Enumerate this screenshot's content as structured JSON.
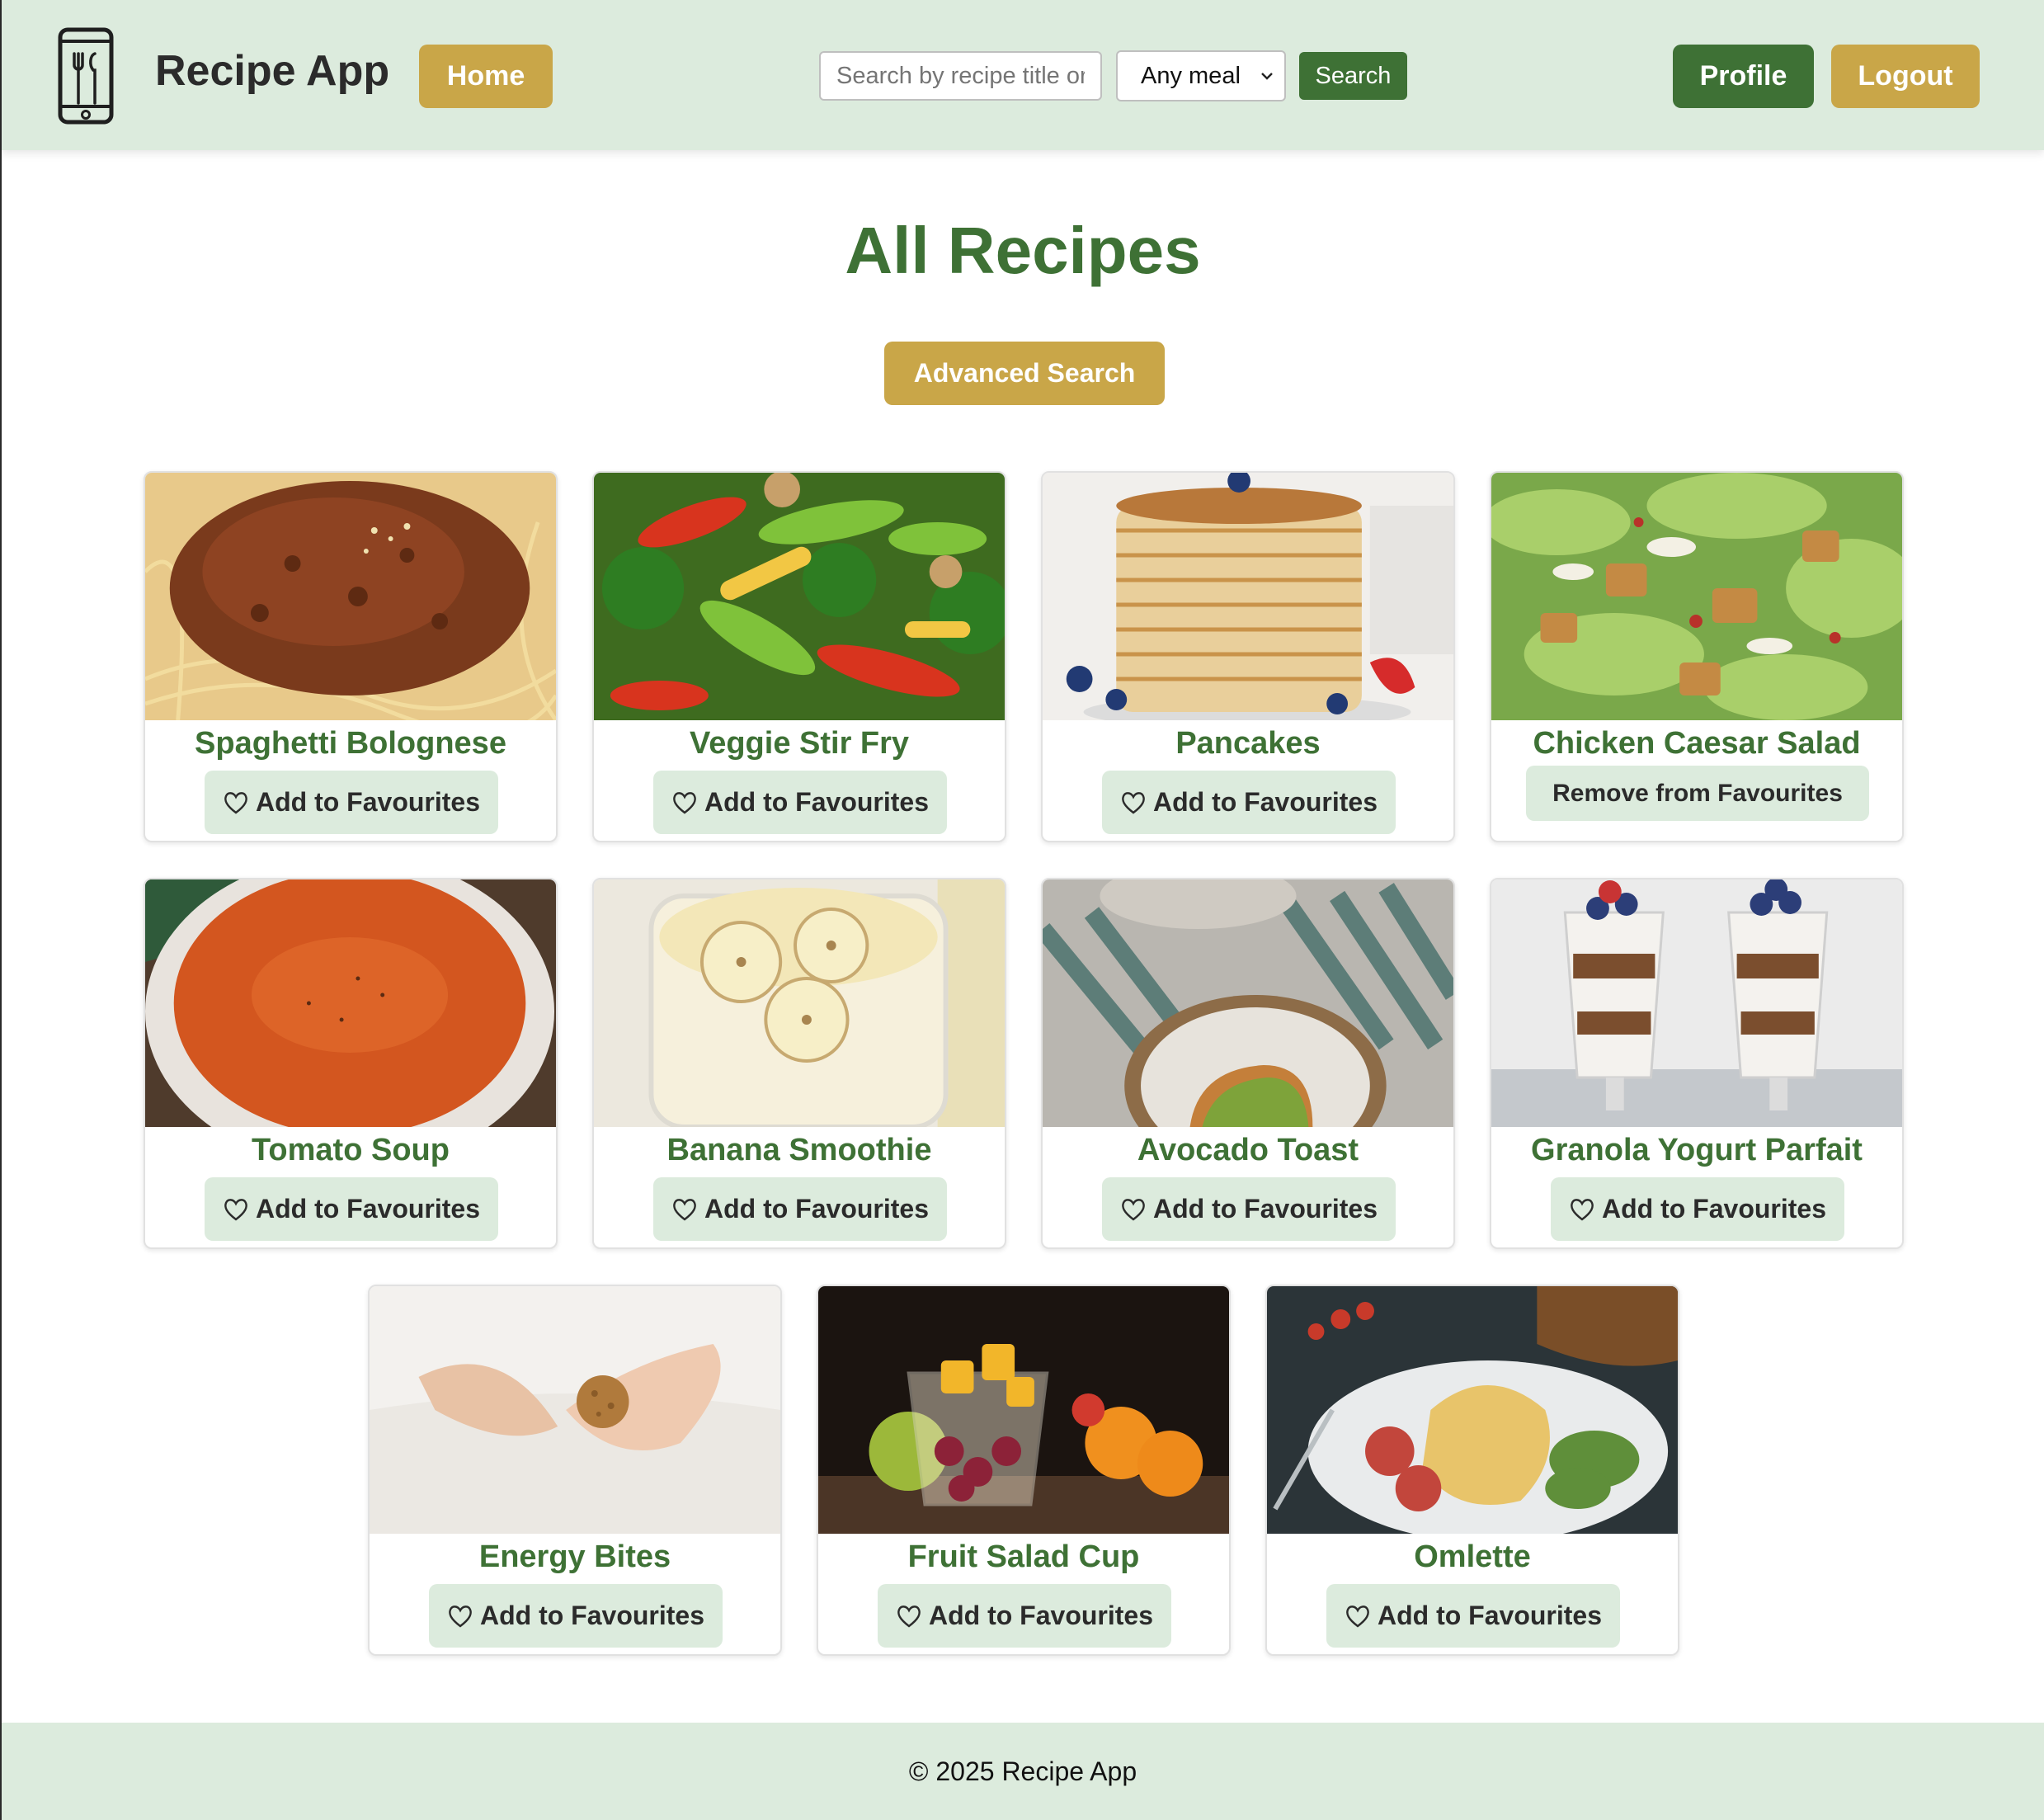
{
  "header": {
    "app_title": "Recipe App",
    "logo_icon": "phone-utensils-icon",
    "home_label": "Home",
    "search_placeholder": "Search by recipe title or",
    "meal_selected": "Any meal",
    "search_label": "Search",
    "profile_label": "Profile",
    "logout_label": "Logout"
  },
  "main": {
    "title": "All Recipes",
    "advanced_search_label": "Advanced Search",
    "recipes": [
      {
        "title": "Spaghetti Bolognese",
        "action": "Add to Favourites",
        "favourited": false
      },
      {
        "title": "Veggie Stir Fry",
        "action": "Add to Favourites",
        "favourited": false
      },
      {
        "title": "Pancakes",
        "action": "Add to Favourites",
        "favourited": false
      },
      {
        "title": "Chicken Caesar Salad",
        "action": "Remove from Favourites",
        "favourited": true
      },
      {
        "title": "Tomato Soup",
        "action": "Add to Favourites",
        "favourited": false
      },
      {
        "title": "Banana Smoothie",
        "action": "Add to Favourites",
        "favourited": false
      },
      {
        "title": "Avocado Toast",
        "action": "Add to Favourites",
        "favourited": false
      },
      {
        "title": "Granola Yogurt Parfait",
        "action": "Add to Favourites",
        "favourited": false
      },
      {
        "title": "Energy Bites",
        "action": "Add to Favourites",
        "favourited": false
      },
      {
        "title": "Fruit Salad Cup",
        "action": "Add to Favourites",
        "favourited": false
      },
      {
        "title": "Omlette",
        "action": "Add to Favourites",
        "favourited": false
      }
    ]
  },
  "footer": {
    "copyright": "© 2025 Recipe App"
  },
  "colors": {
    "header_bg": "#dcebdd",
    "primary_green": "#3e7135",
    "accent_gold": "#c9a648"
  }
}
